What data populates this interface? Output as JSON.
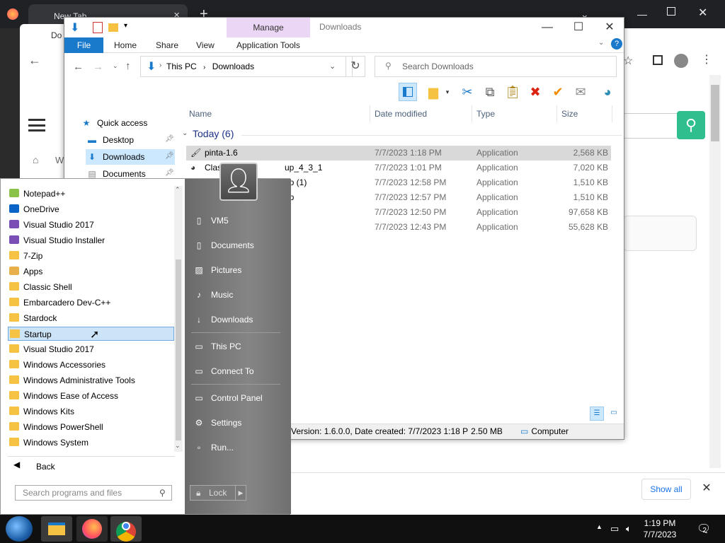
{
  "browser": {
    "tab_title": "New Tab",
    "tab_close": "✕",
    "new_tab": "+",
    "partial_tab": "Do",
    "partial_breadcrumb": "W",
    "search_icon": "search-icon",
    "show_all": "Show all",
    "close_bar": "✕"
  },
  "explorer": {
    "title": "Downloads",
    "manage_label": "Manage",
    "ribbon_tabs": [
      "File",
      "Home",
      "Share",
      "View",
      "Application Tools"
    ],
    "address": {
      "root": "This PC",
      "folder": "Downloads"
    },
    "search_placeholder": "Search Downloads",
    "nav": [
      {
        "label": "Quick access",
        "icon": "star-icon"
      },
      {
        "label": "Desktop",
        "icon": "desktop-icon"
      },
      {
        "label": "Downloads",
        "icon": "download-icon"
      },
      {
        "label": "Documents",
        "icon": "documents-icon"
      }
    ],
    "columns": [
      "Name",
      "Date modified",
      "Type",
      "Size"
    ],
    "group": "Today (6)",
    "files": [
      {
        "name": "pinta-1.6",
        "date": "7/7/2023 1:18 PM",
        "type": "Application",
        "size": "2,568 KB"
      },
      {
        "name": "Clas",
        "name_tail": "up_4_3_1",
        "date": "7/7/2023 1:01 PM",
        "type": "Application",
        "size": "7,020 KB"
      },
      {
        "name": "",
        "name_tail": "up (1)",
        "date": "7/7/2023 12:58 PM",
        "type": "Application",
        "size": "1,510 KB"
      },
      {
        "name": "",
        "name_tail": "up",
        "date": "7/7/2023 12:57 PM",
        "type": "Application",
        "size": "1,510 KB"
      },
      {
        "name": "",
        "name_tail": "",
        "date": "7/7/2023 12:50 PM",
        "type": "Application",
        "size": "97,658 KB"
      },
      {
        "name": "",
        "name_tail": "",
        "date": "7/7/2023 12:43 PM",
        "type": "Application",
        "size": "55,628 KB"
      }
    ],
    "status": "Version: 1.6.0.0, Date created: 7/7/2023 1:18 P",
    "status_size": "2.50 MB",
    "status_location": "Computer"
  },
  "start_menu": {
    "programs": [
      {
        "label": "Notepad++",
        "icon": "notepadpp-icon"
      },
      {
        "label": "OneDrive",
        "icon": "onedrive-icon"
      },
      {
        "label": "Visual Studio 2017",
        "icon": "visual-studio-icon"
      },
      {
        "label": "Visual Studio Installer",
        "icon": "vs-installer-icon"
      },
      {
        "label": "7-Zip",
        "icon": "folder-icon"
      },
      {
        "label": "Apps",
        "icon": "apps-icon"
      },
      {
        "label": "Classic Shell",
        "icon": "folder-icon"
      },
      {
        "label": "Embarcadero Dev-C++",
        "icon": "folder-icon"
      },
      {
        "label": "Stardock",
        "icon": "folder-icon"
      },
      {
        "label": "Startup",
        "icon": "folder-icon"
      },
      {
        "label": "Visual Studio 2017",
        "icon": "folder-icon"
      },
      {
        "label": "Windows Accessories",
        "icon": "folder-icon"
      },
      {
        "label": "Windows Administrative Tools",
        "icon": "folder-icon"
      },
      {
        "label": "Windows Ease of Access",
        "icon": "folder-icon"
      },
      {
        "label": "Windows Kits",
        "icon": "folder-icon"
      },
      {
        "label": "Windows PowerShell",
        "icon": "folder-icon"
      },
      {
        "label": "Windows System",
        "icon": "folder-icon"
      }
    ],
    "selected_program": "Startup",
    "back_label": "Back",
    "search_placeholder": "Search programs and files",
    "right_items": [
      "VM5",
      "Documents",
      "Pictures",
      "Music",
      "Downloads",
      "This PC",
      "Connect To",
      "Control Panel",
      "Settings",
      "Run..."
    ],
    "lock_label": "Lock"
  },
  "taskbar": {
    "time": "1:19 PM",
    "date": "7/7/2023",
    "notification_count": "2"
  }
}
